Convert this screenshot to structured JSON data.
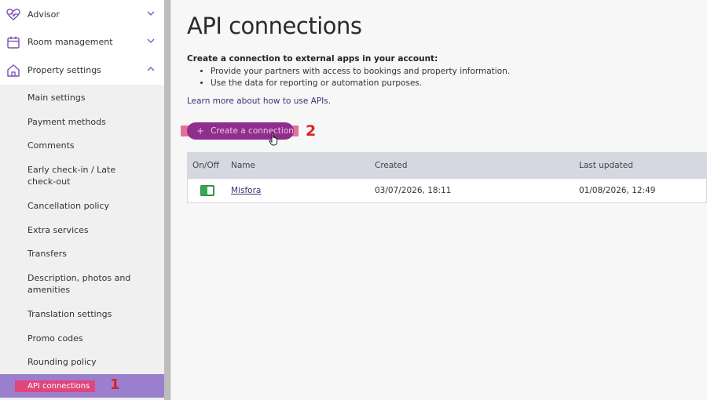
{
  "sidebar": {
    "top_items": [
      {
        "label": "Advisor",
        "icon": "heart-pulse-icon",
        "expanded": false
      },
      {
        "label": "Room management",
        "icon": "calendar-icon",
        "expanded": false
      },
      {
        "label": "Property settings",
        "icon": "house-icon",
        "expanded": true
      }
    ],
    "sub_items": [
      {
        "label": "Main settings"
      },
      {
        "label": "Payment methods"
      },
      {
        "label": "Comments"
      },
      {
        "label": "Early check-in / Late check-out"
      },
      {
        "label": "Cancellation policy"
      },
      {
        "label": "Extra services"
      },
      {
        "label": "Transfers"
      },
      {
        "label": "Description, photos and amenities"
      },
      {
        "label": "Translation settings"
      },
      {
        "label": "Promo codes"
      },
      {
        "label": "Rounding policy"
      },
      {
        "label": "API connections",
        "active": true
      }
    ],
    "marker": "1"
  },
  "main": {
    "title": "API connections",
    "intro_heading": "Create a connection to external apps in your account:",
    "bullets": [
      "Provide your partners with access to bookings and property information.",
      "Use the data for reporting or automation purposes."
    ],
    "learn_more": "Learn more about how to use APIs.",
    "create_button": {
      "plus": "+",
      "label": "Create a connection"
    },
    "marker": "2",
    "table": {
      "headers": {
        "onoff": "On/Off",
        "name": "Name",
        "created": "Created",
        "updated": "Last updated"
      },
      "rows": [
        {
          "enabled": true,
          "name": "Misfora",
          "created": "03/07/2026, 18:11",
          "updated": "01/08/2026, 12:49"
        }
      ]
    }
  },
  "colors": {
    "accent": "#8e2e8f",
    "active_item_bg": "#9b7fcf",
    "highlight": "#e0457b",
    "marker": "#e02020",
    "toggle_on": "#3aa655",
    "link": "#3a3272"
  }
}
